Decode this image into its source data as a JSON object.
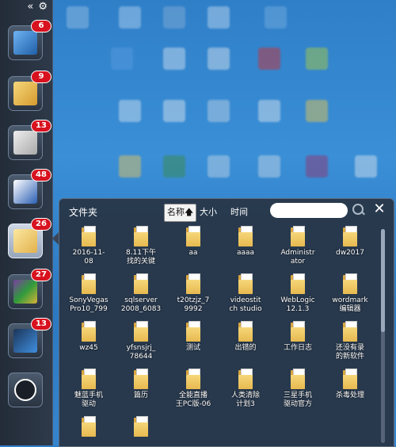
{
  "dock": {
    "collapse_glyph": "«",
    "settings_glyph": "⚙",
    "items": [
      {
        "icon": "computer-icon",
        "badge": "6"
      },
      {
        "icon": "shortcut-folder-icon",
        "badge": "9"
      },
      {
        "icon": "settings-cabinet-icon",
        "badge": "13"
      },
      {
        "icon": "word-document-icon",
        "badge": "48"
      },
      {
        "icon": "folder-icon",
        "badge": "26"
      },
      {
        "icon": "winrar-icon",
        "badge": "27"
      },
      {
        "icon": "media-player-icon",
        "badge": "13"
      },
      {
        "icon": "restore-icon",
        "badge": ""
      }
    ]
  },
  "popup": {
    "title": "文件夹",
    "sort_name": "名称",
    "sort_arrow": "🡅",
    "sort_size": "大小",
    "sort_time": "时间",
    "search_placeholder": "",
    "close_glyph": "✕"
  },
  "folders": [
    "2016-11-\n08",
    "8.11下午\n找的关键",
    "aa",
    "aaaa",
    "Administr\nator",
    "dw2017",
    "SonyVegas\nPro10_799",
    "sqlserver\n2008_6083",
    "t20tzjz_7\n9992",
    "videostit\nch studio",
    "WebLogic\n12.1.3",
    "wordmark\n编辑器",
    "wz45",
    "yfsnsjrj_\n78644",
    "测试",
    "出错的",
    "工作日志",
    "还没有录\n的新软件",
    "魅蓝手机\n驱动",
    "篇历",
    "全能直播\n王PC版-06",
    "人类清除\n计划3",
    "三星手机\n驱动官方",
    "杀毒处理",
    "",
    ""
  ]
}
